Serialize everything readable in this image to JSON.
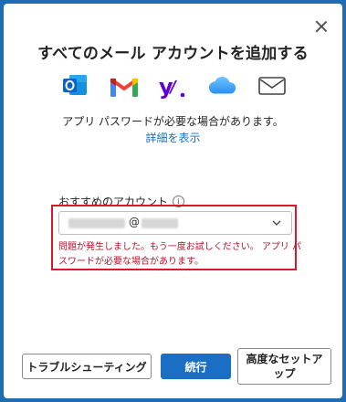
{
  "dialog": {
    "title": "すべてのメール アカウントを追加する",
    "providers": [
      {
        "name": "outlook-icon",
        "color": "#0a64c8"
      },
      {
        "name": "gmail-icon",
        "color": "#ea4335"
      },
      {
        "name": "yahoo-icon",
        "color": "#6001d2"
      },
      {
        "name": "icloud-icon",
        "color": "#3aa3f5"
      },
      {
        "name": "mail-icon",
        "color": "#444444"
      }
    ],
    "app_password_text": "アプリ パスワードが必要な場合があります。",
    "details_link": "詳細を表示",
    "recommended_label": "おすすめのアカウント",
    "info_icon_glyph": "i",
    "account_at_symbol": "@",
    "error_line1": "問題が発生しました。もう一度お試しください。 アプリ パ",
    "error_line2": "スワードが必要な場合があります。",
    "buttons": {
      "troubleshoot": "トラブルシューティング",
      "continue": "続行",
      "advanced": "高度なセットアップ"
    },
    "colors": {
      "accent": "#1a6fc4",
      "error": "#d9182b"
    }
  }
}
